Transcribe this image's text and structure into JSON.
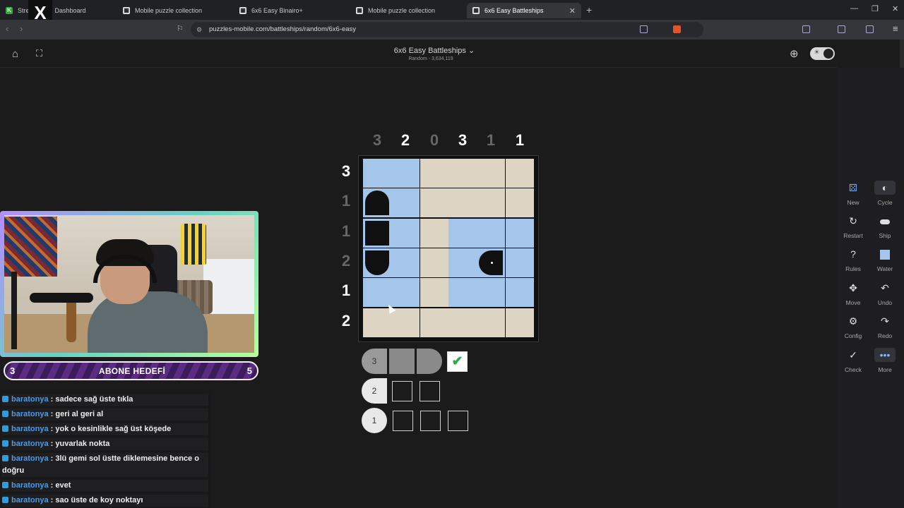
{
  "browser": {
    "tabs": [
      {
        "label": "Stre",
        "icon": "k-icon"
      },
      {
        "label": "Dashboard",
        "icon": "x-icon"
      },
      {
        "label": "Mobile puzzle collection",
        "icon": "puzzle-icon"
      },
      {
        "label": "6x6 Easy Binairo+",
        "icon": "puzzle-icon"
      },
      {
        "label": "Mobile puzzle collection",
        "icon": "puzzle-icon"
      },
      {
        "label": "6x6 Easy Battleships",
        "icon": "puzzle-icon"
      }
    ],
    "url": "puzzles-mobile.com/battleships/random/6x6-easy"
  },
  "header": {
    "title": "6x6 Easy Battleships ⌄",
    "subtitle": "Random - 3,634,119"
  },
  "puzzle": {
    "col_clues": [
      "3",
      "2",
      "0",
      "3",
      "1",
      "1"
    ],
    "col_clue_states": [
      "done",
      "active",
      "done",
      "active",
      "done",
      "active"
    ],
    "row_clues": [
      "3",
      "1",
      "1",
      "2",
      "1",
      "2"
    ],
    "row_clue_states": [
      "active",
      "done",
      "done",
      "done",
      "active",
      "active"
    ],
    "grid": [
      [
        "water",
        "water",
        "empty",
        "empty",
        "empty",
        "empty"
      ],
      [
        "top",
        "water",
        "empty",
        "empty",
        "empty",
        "empty"
      ],
      [
        "mid",
        "water",
        "empty",
        "water",
        "water",
        "water"
      ],
      [
        "bottom",
        "water",
        "empty",
        "water",
        "left-dot",
        "water"
      ],
      [
        "water",
        "water",
        "empty",
        "water",
        "water",
        "water"
      ],
      [
        "empty",
        "empty",
        "empty",
        "empty",
        "empty",
        "empty"
      ]
    ]
  },
  "fleet": {
    "rows": [
      {
        "size": "3",
        "found": 3,
        "unfound": 0,
        "complete": true
      },
      {
        "size": "2",
        "found": 1,
        "unfound": 2,
        "complete": false
      },
      {
        "size": "1",
        "found": 0,
        "unfound": 3,
        "complete": false
      }
    ]
  },
  "tools": {
    "new": "New",
    "cycle": "Cycle",
    "restart": "Restart",
    "ship": "Ship",
    "rules": "Rules",
    "water": "Water",
    "move": "Move",
    "undo": "Undo",
    "config": "Config",
    "redo": "Redo",
    "check": "Check",
    "more": "More"
  },
  "goal": {
    "current": "3",
    "label": "ABONE HEDEFİ",
    "target": "5"
  },
  "chat": [
    {
      "user": "baratonya",
      "text": ": sadece sağ üste tıkla"
    },
    {
      "user": "baratonya",
      "text": ": geri al geri al"
    },
    {
      "user": "baratonya",
      "text": ": yok o kesinlikle sağ üst köşede"
    },
    {
      "user": "baratonya",
      "text": ": yuvarlak nokta"
    },
    {
      "user": "baratonya",
      "text": ": 3lü gemi sol üstte diklemesine bence o doğru"
    },
    {
      "user": "baratonya",
      "text": ": evet"
    },
    {
      "user": "baratonya",
      "text": ": sao üste de koy noktayı"
    }
  ],
  "colors": {
    "water": "#a4c6ea",
    "empty": "#ddd4c4",
    "ship": "#101010",
    "clue_active": "#ffffff",
    "clue_done": "#666666"
  }
}
